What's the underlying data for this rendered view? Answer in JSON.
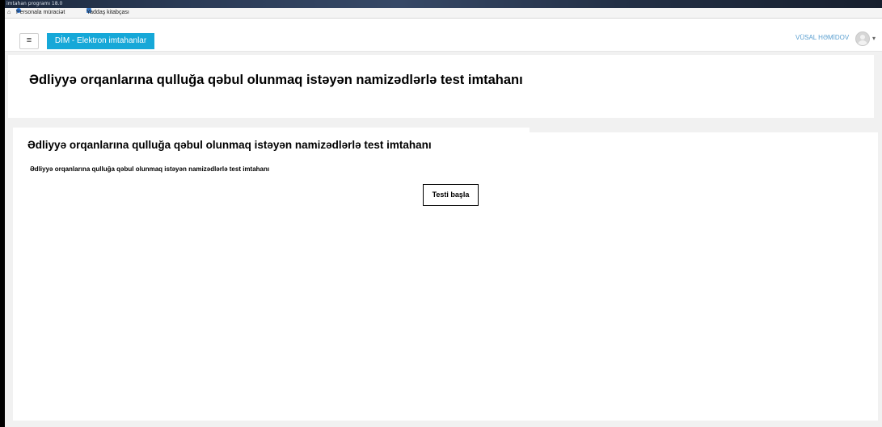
{
  "window": {
    "title": "imtahan programı 18.0"
  },
  "bookmarks": {
    "items": [
      {
        "label": "Personala müraciət"
      },
      {
        "label": "Yaddaş kitabçası"
      }
    ]
  },
  "navbar": {
    "brand": "DİM - Elektron imtahanlar",
    "user_name": "VÜSAL HƏMİDOV",
    "menu_icon": "hamburger-icon",
    "avatar_icon": "user-avatar-icon",
    "accent_color": "#16a8d8"
  },
  "page": {
    "header_title": "Ədliyyə orqanlarına qulluğa qəbul olunmaq istəyən namizədlərlə test imtahanı",
    "activity_title": "Ədliyyə orqanlarına qulluğa qəbul olunmaq istəyən namizədlərlə test imtahanı",
    "description": "Ədliyyə orqanlarına qulluğa qəbul olunmaq istəyən namizədlərlə test imtahanı",
    "start_button": "Testi başla"
  }
}
